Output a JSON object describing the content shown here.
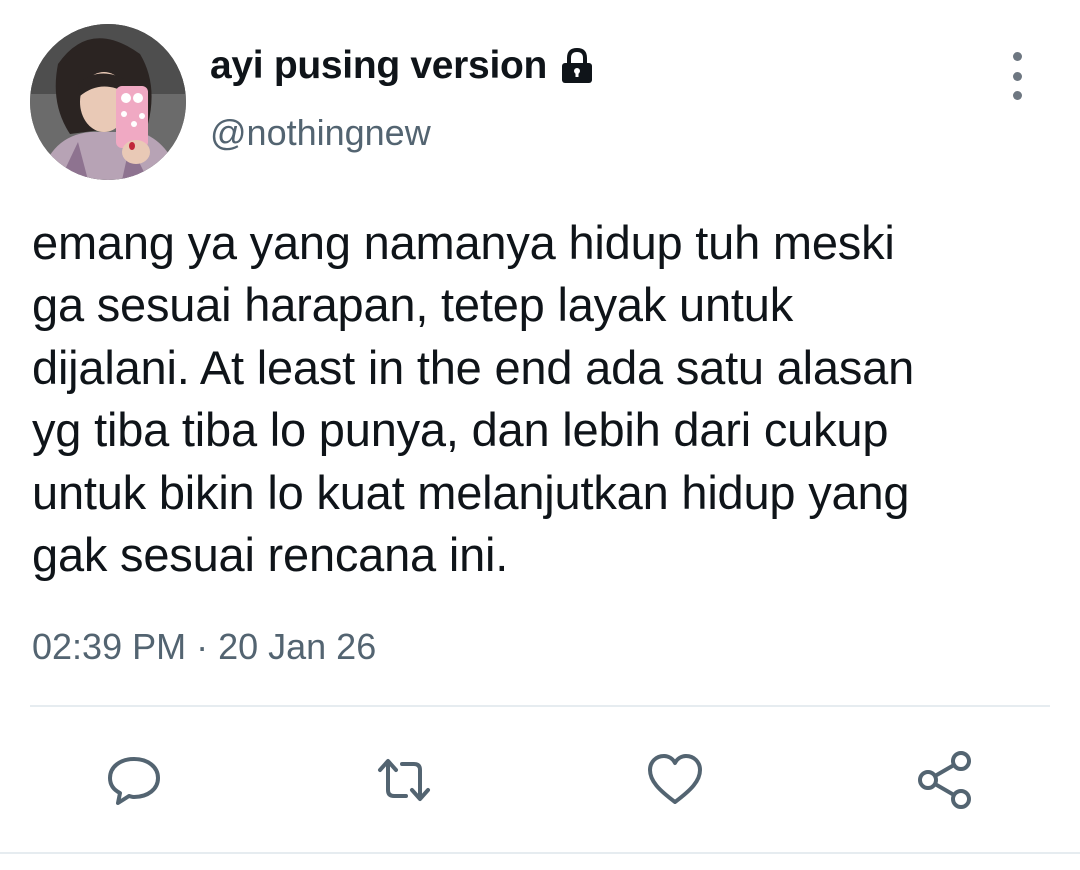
{
  "user": {
    "display_name": "ayi pusing version",
    "handle": "@nothingnew",
    "protected_icon": "lock-icon",
    "avatar_icon": "avatar"
  },
  "tweet": {
    "lines": [
      "emang ya yang namanya hidup tuh meski",
      "ga sesuai harapan, tetep layak untuk",
      "dijalani. At least in the end ada satu alasan",
      "yg tiba tiba lo punya, dan lebih dari cukup",
      "untuk bikin lo kuat melanjutkan hidup yang",
      "gak sesuai rencana ini."
    ],
    "timestamp": "02:39 PM · 20 Jan 26"
  },
  "actions": [
    {
      "name": "reply",
      "icon": "reply-icon"
    },
    {
      "name": "retweet",
      "icon": "retweet-icon"
    },
    {
      "name": "like",
      "icon": "heart-icon"
    },
    {
      "name": "share",
      "icon": "share-icon"
    }
  ],
  "colors": {
    "text_primary": "#0f1419",
    "text_secondary": "#536471",
    "icon": "#536471",
    "divider": "#e6ecf0"
  }
}
